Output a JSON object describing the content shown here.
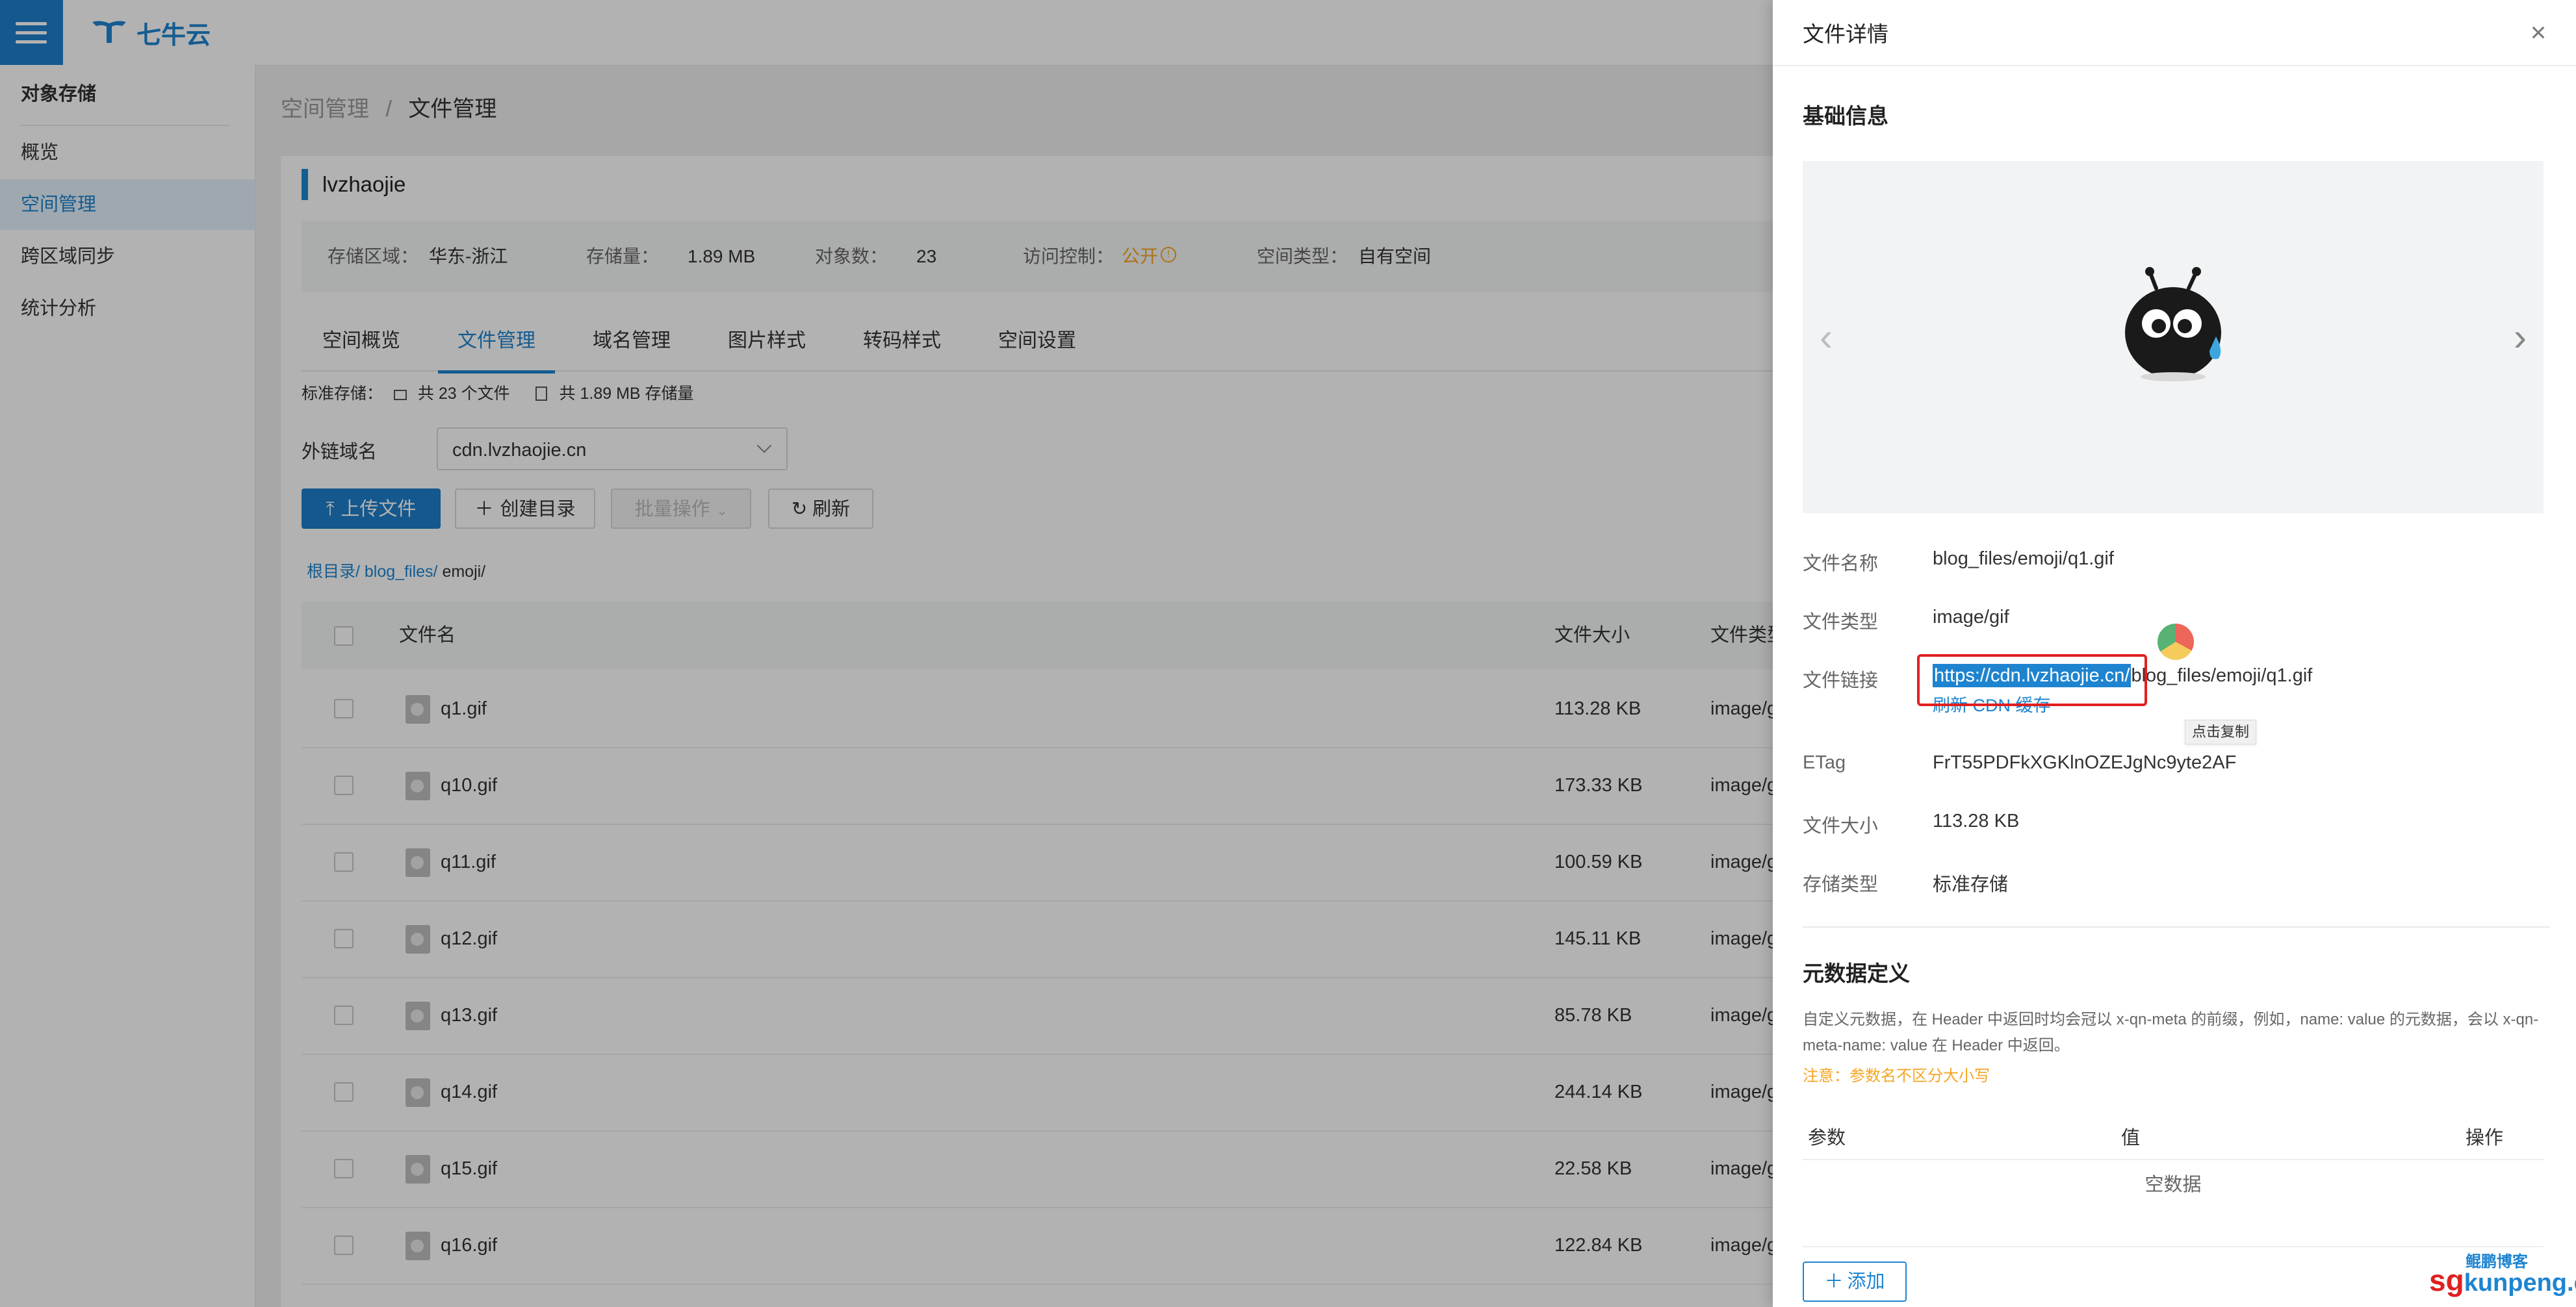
{
  "brand": {
    "name": "七牛云"
  },
  "sidebar": {
    "header": "对象存储",
    "items": [
      {
        "label": "概览"
      },
      {
        "label": "空间管理"
      },
      {
        "label": "跨区域同步"
      },
      {
        "label": "统计分析"
      }
    ]
  },
  "breadcrumb": {
    "parent": "空间管理",
    "sep": "/",
    "current": "文件管理"
  },
  "bucket": {
    "name": "lvzhaojie",
    "region_label": "存储区域：",
    "region": "华东-浙江",
    "storage_label": "存储量：",
    "storage": "1.89 MB",
    "objects_label": "对象数：",
    "objects": "23",
    "access_label": "访问控制：",
    "access": "公开",
    "type_label": "空间类型：",
    "type": "自有空间"
  },
  "tabs": [
    {
      "label": "空间概览"
    },
    {
      "label": "文件管理"
    },
    {
      "label": "域名管理"
    },
    {
      "label": "图片样式"
    },
    {
      "label": "转码样式"
    },
    {
      "label": "空间设置"
    }
  ],
  "summary": {
    "prefix": "标准存储：",
    "files": "共 23 个文件",
    "size": "共 1.89 MB 存储量"
  },
  "domain": {
    "label": "外链域名",
    "value": "cdn.lvzhaojie.cn"
  },
  "toolbar": {
    "upload": "上传文件",
    "mkdir": "创建目录",
    "batch": "批量操作",
    "refresh": "刷新"
  },
  "path": {
    "root": "根目录/",
    "level1": "blog_files/",
    "current": "emoji/"
  },
  "table": {
    "col_name": "文件名",
    "col_size": "文件大小",
    "col_type": "文件类型",
    "rows": [
      {
        "name": "q1.gif",
        "size": "113.28 KB",
        "type": "image/gif"
      },
      {
        "name": "q10.gif",
        "size": "173.33 KB",
        "type": "image/gif"
      },
      {
        "name": "q11.gif",
        "size": "100.59 KB",
        "type": "image/gif"
      },
      {
        "name": "q12.gif",
        "size": "145.11 KB",
        "type": "image/gif"
      },
      {
        "name": "q13.gif",
        "size": "85.78 KB",
        "type": "image/gif"
      },
      {
        "name": "q14.gif",
        "size": "244.14 KB",
        "type": "image/gif"
      },
      {
        "name": "q15.gif",
        "size": "22.58 KB",
        "type": "image/gif"
      },
      {
        "name": "q16.gif",
        "size": "122.84 KB",
        "type": "image/gif"
      }
    ]
  },
  "drawer": {
    "title": "文件详情",
    "basic_title": "基础信息",
    "fields": {
      "name_label": "文件名称",
      "name": "blog_files/emoji/q1.gif",
      "type_label": "文件类型",
      "type": "image/gif",
      "link_label": "文件链接",
      "link_domain": "https://cdn.lvzhaojie.cn/",
      "link_path": "blog_files/emoji/q1.gif",
      "refresh_cdn": "刷新 CDN 缓存",
      "copy_tip": "点击复制",
      "etag_label": "ETag",
      "etag": "FrT55PDFkXGKlnOZEJgNc9yte2AF",
      "size_label": "文件大小",
      "size": "113.28 KB",
      "storage_label": "存储类型",
      "storage": "标准存储"
    },
    "meta": {
      "title": "元数据定义",
      "desc": "自定义元数据，在 Header 中返回时均会冠以 x-qn-meta 的前缀，例如，name: value 的元数据，会以 x-qn-meta-name: value 在 Header 中返回。",
      "note": "注意：参数名不区分大小写",
      "col_param": "参数",
      "col_value": "值",
      "col_op": "操作",
      "empty": "空数据",
      "add": "添加"
    }
  },
  "watermark": {
    "sg": "sg",
    "kunpeng": "kunpeng.cn",
    "cn_name": "鲲鹏博客"
  },
  "colors": {
    "accent": "#1e84d0",
    "warning": "#f5a623",
    "highlight_border": "#e02020"
  }
}
